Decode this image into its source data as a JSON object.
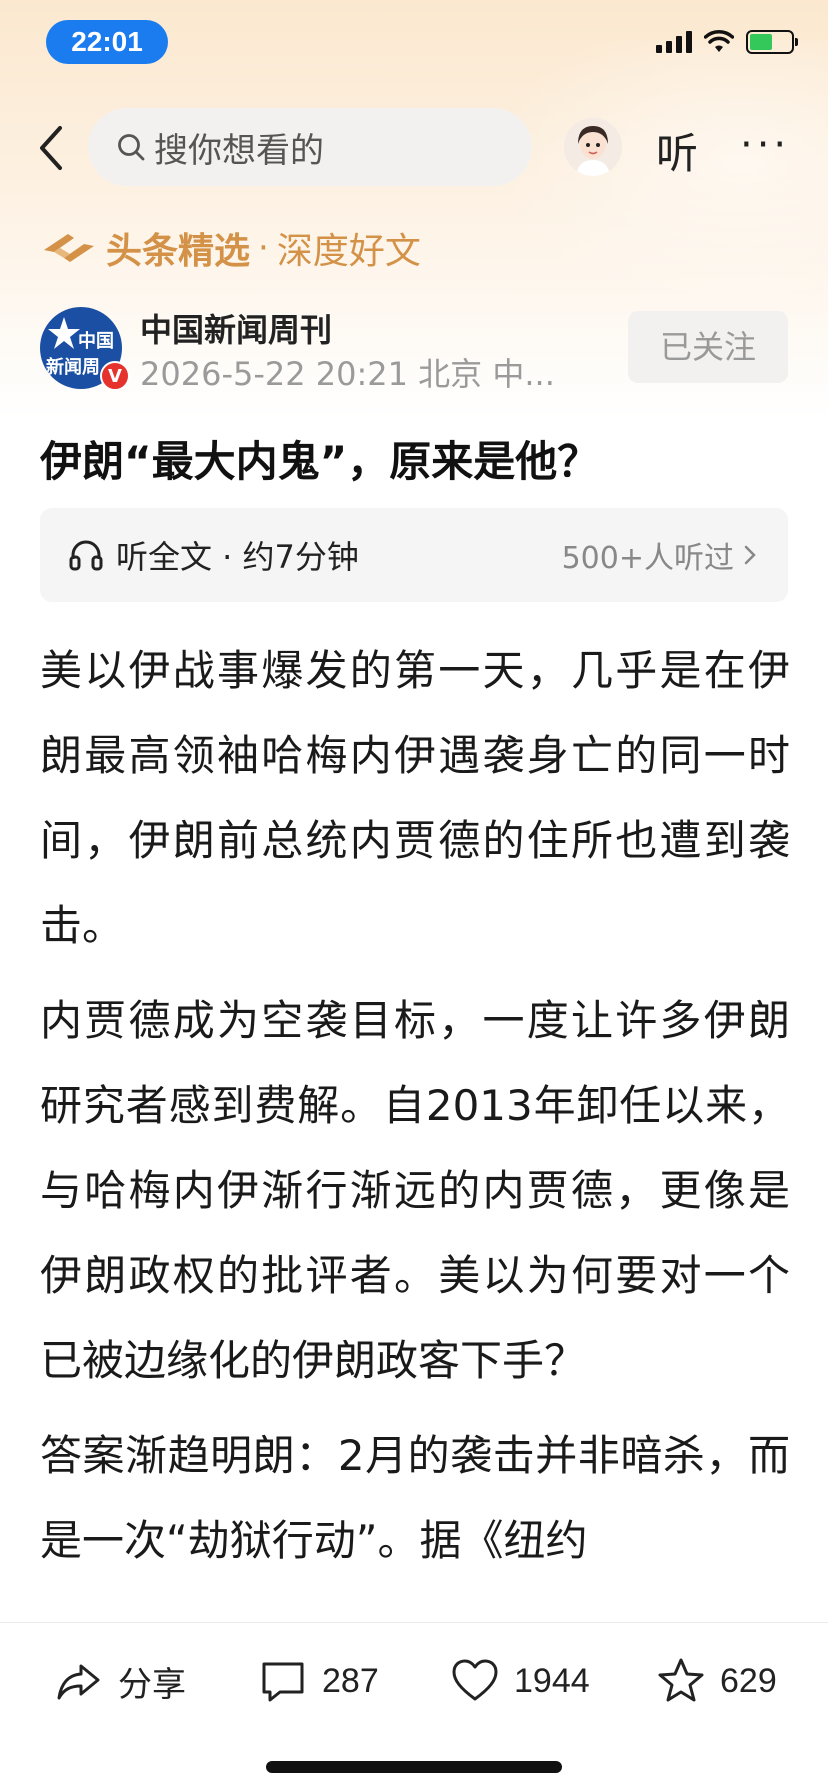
{
  "status_bar": {
    "time": "22:01",
    "battery_level": 0.55,
    "accent_color": "#1b7cf0"
  },
  "nav": {
    "search_placeholder": "搜你想看的",
    "listen_label": "听",
    "more_label": "···"
  },
  "featured": {
    "title": "头条精选",
    "separator": "·",
    "subtitle": "深度好文"
  },
  "author": {
    "name": "中国新闻周刊",
    "avatar_text_1": "中国",
    "avatar_text_2": "新闻周",
    "verified_badge": "V",
    "meta": "2026-5-22 20:21 北京 中...",
    "follow_label": "已关注"
  },
  "article": {
    "title": "伊朗“最大内鬼”，原来是他？",
    "listen_bar": {
      "label": "听全文 · 约7分钟",
      "count": "500+人听过"
    },
    "paragraphs": [
      "美以伊战事爆发的第一天，几乎是在伊朗最高领袖哈梅内伊遇袭身亡的同一时间，伊朗前总统内贾德的住所也遭到袭击。",
      "内贾德成为空袭目标，一度让许多伊朗研究者感到费解。自2013年卸任以来，与哈梅内伊渐行渐远的内贾德，更像是伊朗政权的批评者。美以为何要对一个已被边缘化的伊朗政客下手？",
      "答案渐趋明朗：2月的袭击并非暗杀，而是一次“劫狱行动”。据《纽约"
    ]
  },
  "bottom_bar": {
    "share_label": "分享",
    "comment_count": "287",
    "like_count": "1944",
    "favorite_count": "629"
  },
  "icons": [
    "back-icon",
    "search-icon",
    "headphone-icon",
    "chevron-right-icon",
    "share-icon",
    "comment-icon",
    "heart-icon",
    "star-icon",
    "signal-icon",
    "wifi-icon",
    "battery-icon"
  ]
}
